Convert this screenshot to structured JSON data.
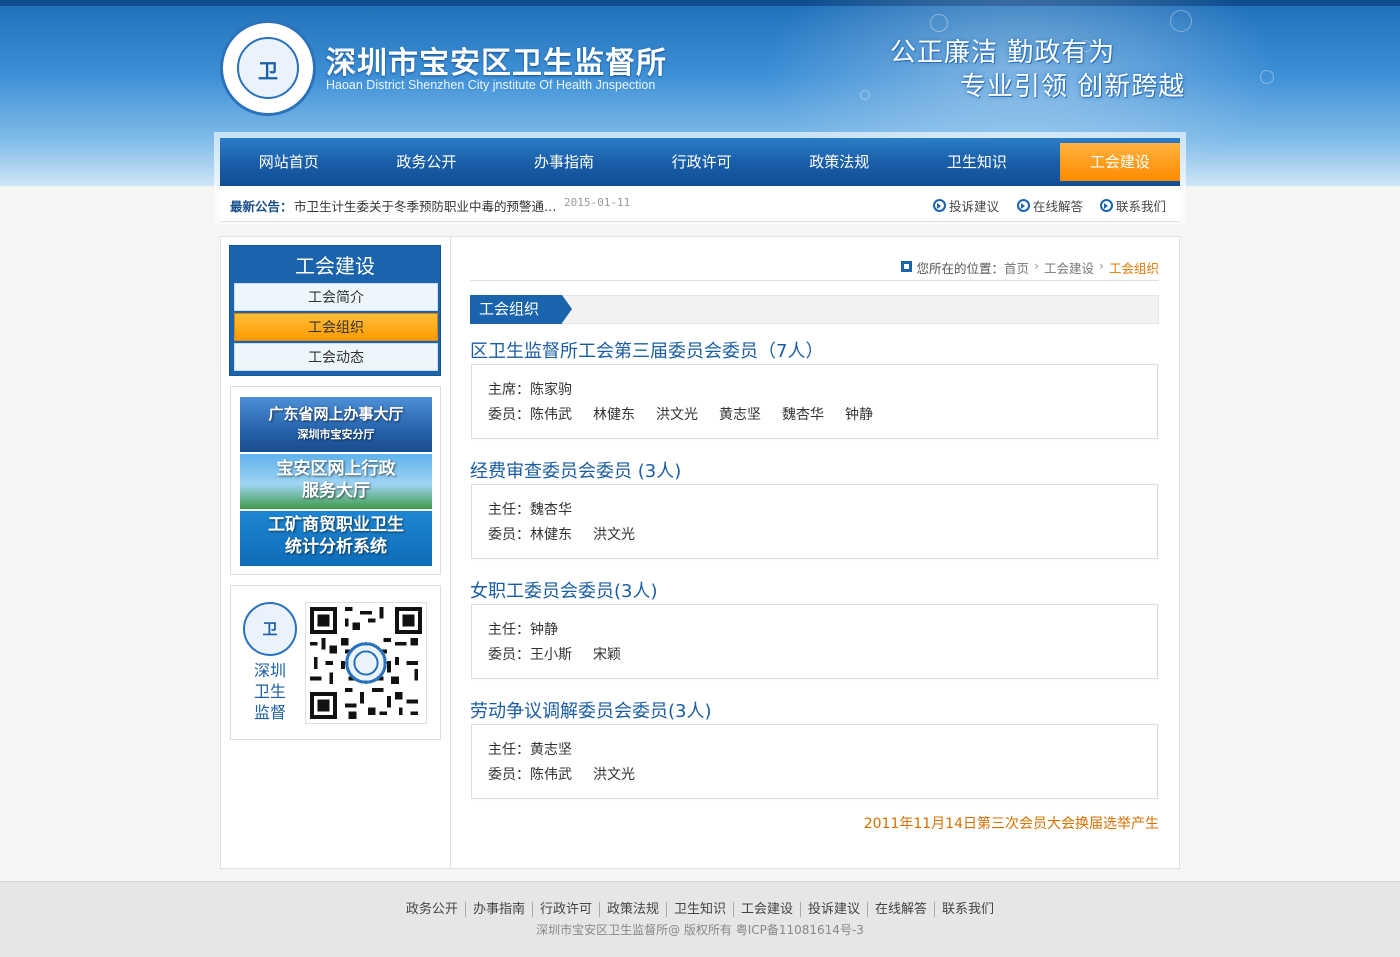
{
  "header": {
    "emblem_text": "卫",
    "site_title": "深圳市宝安区卫生监督所",
    "site_subtitle": "Haoan District Shenzhen City jnstitute Of Health Jnspection",
    "slogan_1": "公正廉洁  勤政有为",
    "slogan_2": "专业引领  创新跨越"
  },
  "nav": {
    "items": [
      "网站首页",
      "政务公开",
      "办事指南",
      "行政许可",
      "政策法规",
      "卫生知识",
      "工会建设"
    ],
    "active_index": 6
  },
  "notice": {
    "label": "最新公告：",
    "text": "市卫生计生委关于冬季预防职业中毒的预警通…",
    "date": "2015-01-11",
    "quick_links": [
      "投诉建议",
      "在线解答",
      "联系我们"
    ]
  },
  "sidebar": {
    "title": "工会建设",
    "items": [
      "工会简介",
      "工会组织",
      "工会动态"
    ],
    "active_index": 1,
    "banners": [
      {
        "line1": "广东省网上办事大厅",
        "line2": "深圳市宝安分厅"
      },
      {
        "line1": "宝安区网上行政",
        "line2": "服务大厅"
      },
      {
        "line1": "工矿商贸职业卫生",
        "line2": "统计分析系统"
      }
    ],
    "qr_name": "深圳卫生监督"
  },
  "breadcrumb": {
    "prefix": "您所在的位置：",
    "home": "首页",
    "parent": "工会建设",
    "current": "工会组织"
  },
  "section_title": "工会组织",
  "groups": [
    {
      "title": "区卫生监督所工会第三届委员会委员（7人）",
      "lead_label": "主席：",
      "lead_name": "陈家驹",
      "members_label": "委员：",
      "members": [
        "陈伟武",
        "林健东",
        "洪文光",
        "黄志坚",
        "魏杏华",
        "钟静"
      ]
    },
    {
      "title": "经费审查委员会委员 (3人)",
      "lead_label": "主任：",
      "lead_name": "魏杏华",
      "members_label": "委员：",
      "members": [
        "林健东",
        "洪文光"
      ]
    },
    {
      "title": "女职工委员会委员(3人)",
      "lead_label": "主任：",
      "lead_name": "钟静",
      "members_label": "委员：",
      "members": [
        "王小斯",
        "宋颖"
      ]
    },
    {
      "title": "劳动争议调解委员会委员(3人)",
      "lead_label": "主任：",
      "lead_name": "黄志坚",
      "members_label": "委员：",
      "members": [
        "陈伟武",
        "洪文光"
      ]
    }
  ],
  "election_note": "2011年11月14日第三次会员大会换届选举产生",
  "footer": {
    "links": [
      "政务公开",
      "办事指南",
      "行政许可",
      "政策法规",
      "卫生知识",
      "工会建设",
      "投诉建议",
      "在线解答",
      "联系我们"
    ],
    "copyright": "深圳市宝安区卫生监督所@ 版权所有   粤ICP备11081614号-3"
  },
  "colors": {
    "brand_blue": "#1a64ad",
    "accent_orange": "#ff9a00",
    "note_orange": "#d86f00"
  }
}
